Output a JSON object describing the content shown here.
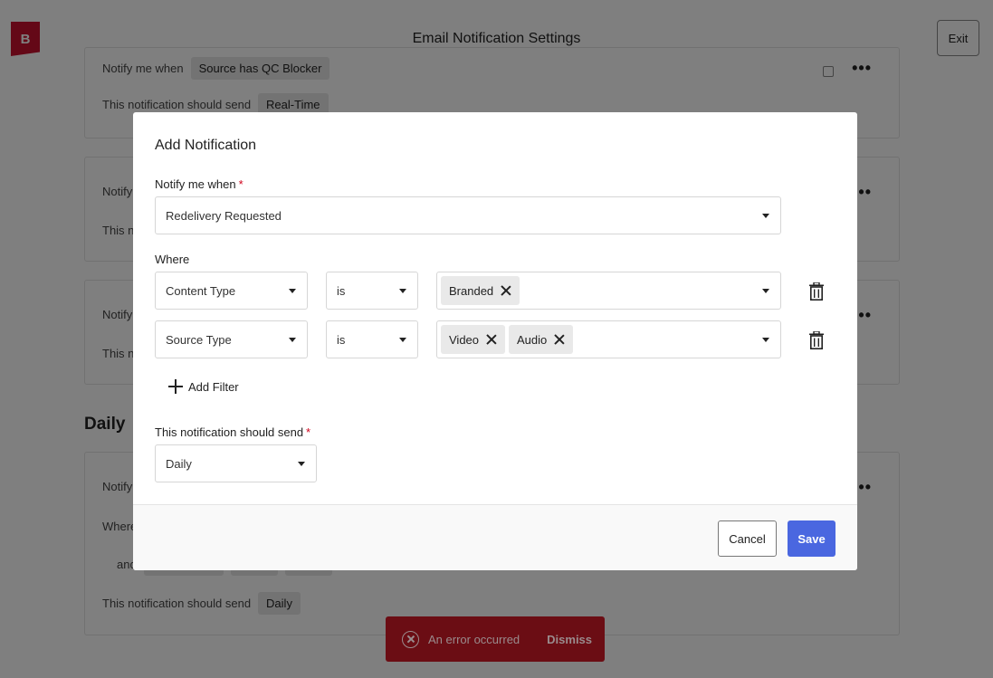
{
  "header": {
    "logo_text": "B",
    "title": "Email Notification Settings",
    "exit_label": "Exit"
  },
  "background": {
    "card1": {
      "notify_label": "Notify me when",
      "notify_value": "Source has QC Blocker",
      "send_label": "This notification should send",
      "send_value": "Real-Time"
    },
    "card2": {
      "notify_label": "Notify",
      "send_label": "This n"
    },
    "card3": {
      "notify_label": "Notify",
      "send_label": "This n"
    },
    "section_heading": "Daily",
    "card4": {
      "notify_label": "Notify",
      "where_label": "Where",
      "and_label": "and",
      "send_label": "This notification should send",
      "send_value": "Daily"
    },
    "more_icon_glyph": "•••"
  },
  "modal": {
    "title": "Add Notification",
    "notify_label": "Notify me when",
    "required_mark": "*",
    "notify_value": "Redelivery Requested",
    "where_label": "Where",
    "filters": [
      {
        "field": "Content Type",
        "operator": "is",
        "values": [
          "Branded"
        ]
      },
      {
        "field": "Source Type",
        "operator": "is",
        "values": [
          "Video",
          "Audio"
        ]
      }
    ],
    "add_filter_label": "Add Filter",
    "send_label": "This notification should send",
    "send_value": "Daily",
    "cancel_label": "Cancel",
    "save_label": "Save"
  },
  "toast": {
    "message": "An error occurred",
    "dismiss_label": "Dismiss"
  },
  "colors": {
    "brand": "#c8102e",
    "primary": "#4a67e0",
    "error_toast": "#6b0d14",
    "required": "#d0021b"
  }
}
